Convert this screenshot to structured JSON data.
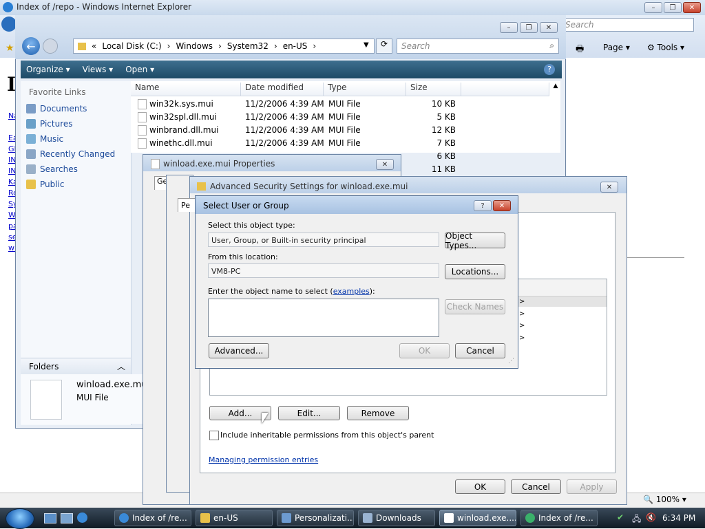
{
  "ie": {
    "title": "Index of /repo - Windows Internet Explorer",
    "search_placeholder": "Search",
    "page_menu": "Page",
    "tools_menu": "Tools",
    "status_zoom": "100%",
    "heading_fragment": "I",
    "side_links": [
      "Na",
      "Ea",
      "GL",
      "IN",
      "IN",
      "Ka",
      "Ro",
      "Sy",
      "W",
      "pa",
      "se",
      "wi"
    ]
  },
  "explorer": {
    "breadcrumb": [
      "«",
      "Local Disk (C:)",
      "Windows",
      "System32",
      "en-US"
    ],
    "search_placeholder": "Search",
    "toolbar": {
      "organize": "Organize",
      "views": "Views",
      "open": "Open"
    },
    "favorite_links_header": "Favorite Links",
    "favorites": [
      "Documents",
      "Pictures",
      "Music",
      "Recently Changed",
      "Searches",
      "Public"
    ],
    "columns": {
      "name": "Name",
      "date": "Date modified",
      "type": "Type",
      "size": "Size"
    },
    "files": [
      {
        "name": "win32k.sys.mui",
        "date": "11/2/2006 4:39 AM",
        "type": "MUI File",
        "size": "10 KB"
      },
      {
        "name": "win32spl.dll.mui",
        "date": "11/2/2006 4:39 AM",
        "type": "MUI File",
        "size": "5 KB"
      },
      {
        "name": "winbrand.dll.mui",
        "date": "11/2/2006 4:39 AM",
        "type": "MUI File",
        "size": "12 KB"
      },
      {
        "name": "winethc.dll.mui",
        "date": "11/2/2006 4:39 AM",
        "type": "MUI File",
        "size": "7 KB"
      },
      {
        "name": "",
        "date": "",
        "type": "",
        "size": "6 KB"
      },
      {
        "name": "",
        "date": "",
        "type": "",
        "size": "11 KB"
      }
    ],
    "folders_label": "Folders",
    "details": {
      "filename": "winload.exe.mui",
      "filetype": "MUI File"
    }
  },
  "properties": {
    "title": "winload.exe.mui Properties",
    "tab_fragment": "Ge"
  },
  "advanced": {
    "title": "Advanced Security Settings for winload.exe.mui",
    "tab_fragment": "Pe",
    "buttons": {
      "add": "Add...",
      "edit": "Edit...",
      "remove": "Remove",
      "ok": "OK",
      "cancel": "Cancel",
      "apply": "Apply"
    },
    "inherit_label": "Include inheritable permissions from this object's parent",
    "inherit_checked": false,
    "manage_link": "Managing permission entries"
  },
  "select_dialog": {
    "title": "Select User or Group",
    "object_type_label": "Select this object type:",
    "object_type_value": "User, Group, or Built-in security principal",
    "object_types_button": "Object Types...",
    "location_label": "From this location:",
    "location_value": "VM8-PC",
    "locations_button": "Locations...",
    "enter_label": "Enter the object name to select",
    "examples_link": "examples",
    "enter_label_suffix": "):",
    "object_name_value": "",
    "check_names_button": "Check Names",
    "advanced_button": "Advanced...",
    "ok_button": "OK",
    "cancel_button": "Cancel"
  },
  "taskbar": {
    "buttons": [
      "Index of /re...",
      "en-US",
      "Personalizati...",
      "Downloads",
      "winload.exe....",
      "Index of /re..."
    ],
    "active_index": 4,
    "clock": "6:34 PM"
  },
  "colors": {
    "taskbar": "#1f2d3a",
    "explorer_command_bar": "#2d5c7a",
    "link": "#0000cc"
  }
}
